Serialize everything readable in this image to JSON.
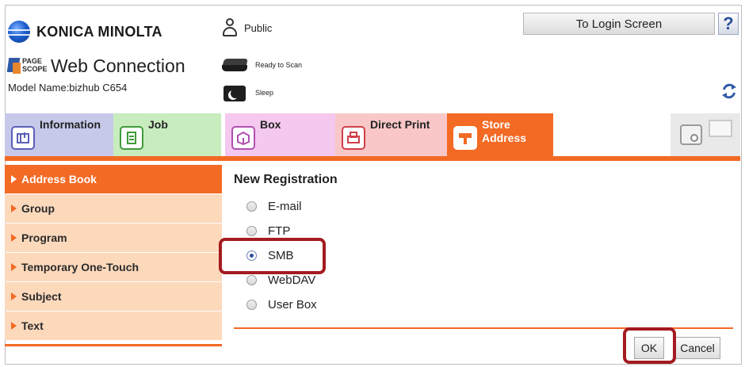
{
  "header": {
    "brand": "KONICA MINOLTA",
    "pagescope_logo_text": "PAGE SCOPE",
    "product_title": "Web Connection",
    "model_name": "Model Name:bizhub C654",
    "user": "Public",
    "status_ready": "Ready to Scan",
    "status_sleep": "Sleep",
    "login_button": "To Login Screen",
    "help_button": "?"
  },
  "tabs": [
    {
      "label": "Information",
      "icon": "information-icon",
      "color": "#c7c9ea"
    },
    {
      "label": "Job",
      "icon": "job-icon",
      "color": "#c8ecbe"
    },
    {
      "label": "Box",
      "icon": "box-icon",
      "color": "#f4c8ef"
    },
    {
      "label": "Direct Print",
      "icon": "direct-print-icon",
      "color": "#f9c7c7"
    },
    {
      "label": "Store\nAddress",
      "icon": "store-address-icon",
      "color": "#f26a24",
      "active": true
    }
  ],
  "sidebar": {
    "items": [
      {
        "label": "Address Book",
        "active": true
      },
      {
        "label": "Group"
      },
      {
        "label": "Program"
      },
      {
        "label": "Temporary One-Touch"
      },
      {
        "label": "Subject"
      },
      {
        "label": "Text"
      }
    ]
  },
  "main": {
    "title": "New Registration",
    "options": [
      {
        "label": "E-mail",
        "selected": false
      },
      {
        "label": "FTP",
        "selected": false
      },
      {
        "label": "SMB",
        "selected": true
      },
      {
        "label": "WebDAV",
        "selected": false
      },
      {
        "label": "User Box",
        "selected": false
      }
    ],
    "ok_button": "OK",
    "cancel_button": "Cancel"
  },
  "colors": {
    "accent": "#f26a24",
    "highlight": "#a31b20"
  }
}
